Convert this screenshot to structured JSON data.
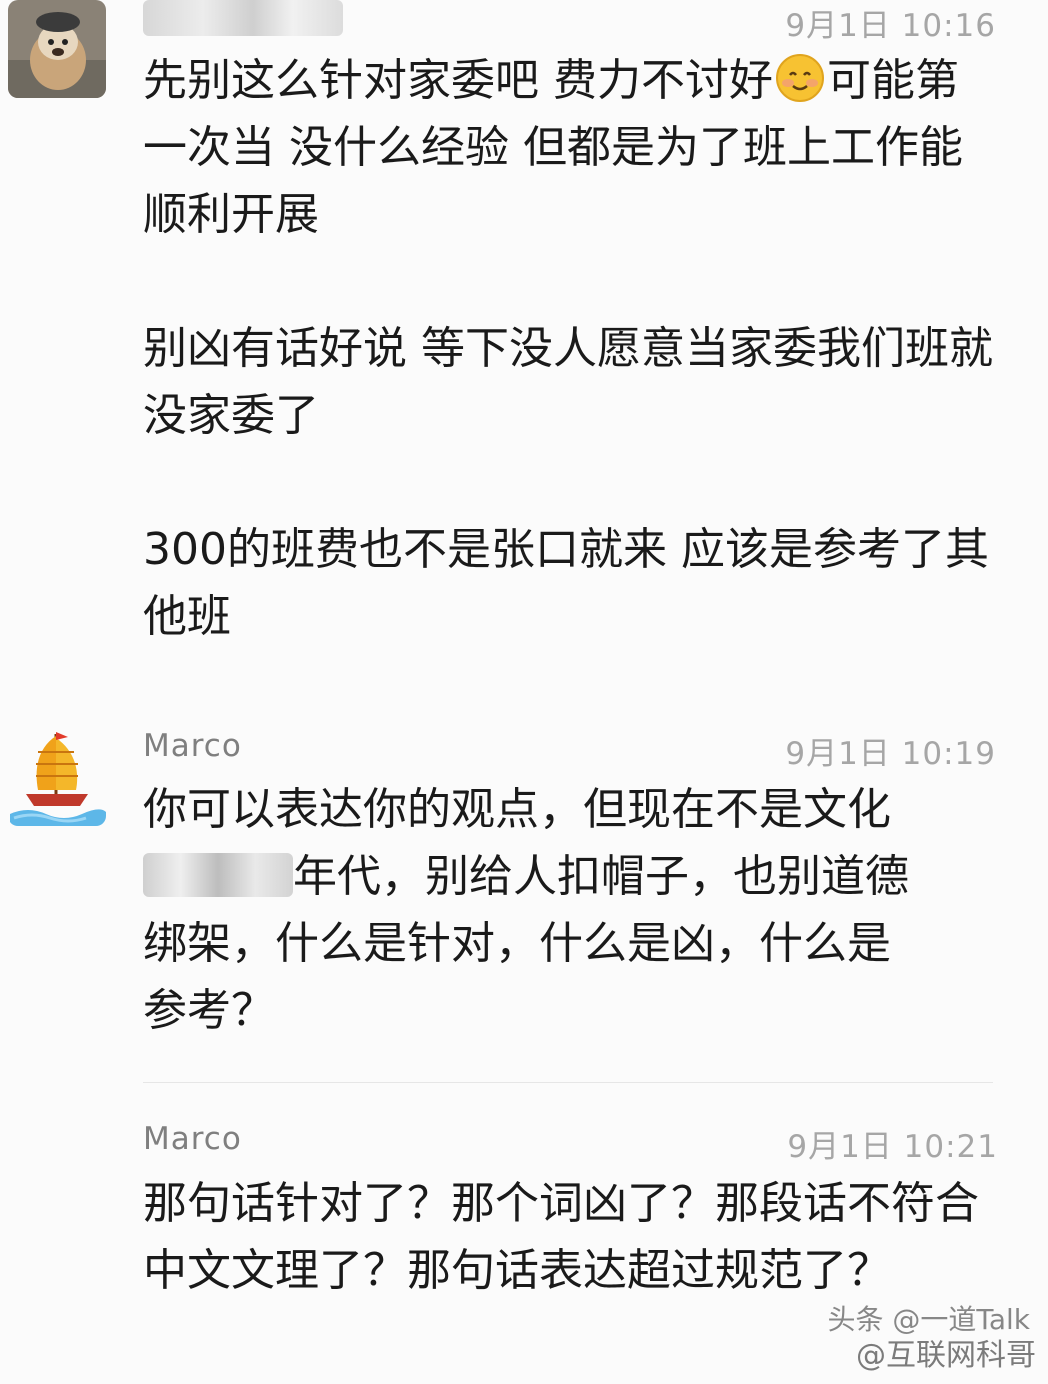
{
  "comments": [
    {
      "name": "",
      "time": "9月1日 10:16",
      "paragraphs": [
        {
          "before": "先别这么针对家委吧 费力不讨好",
          "emoji": "smiling-face-with-rosy-cheeks",
          "after": "可能第一次当 没什么经验 但都是为了班上工作能顺利开展"
        },
        {
          "text": "别凶有话好说 等下没人愿意当家委我们班就没家委了"
        },
        {
          "text": "300的班费也不是张口就来 应该是参考了其他班"
        }
      ]
    },
    {
      "name": "Marco",
      "time": "9月1日 10:19",
      "lines": [
        "你可以表达你的观点，但现在不是文化",
        "年代，别给人扣帽子，也别道德",
        "绑架，什么是针对，什么是凶，什么是",
        "参考？"
      ]
    },
    {
      "name": "Marco",
      "time": "9月1日 10:21",
      "text": "那句话针对了？那个词凶了？那段话不符合中文文理了？那句话表达超过规范了？"
    }
  ],
  "watermark": {
    "top": "头条 @一道Talk",
    "bottom": "@互联网科哥"
  }
}
